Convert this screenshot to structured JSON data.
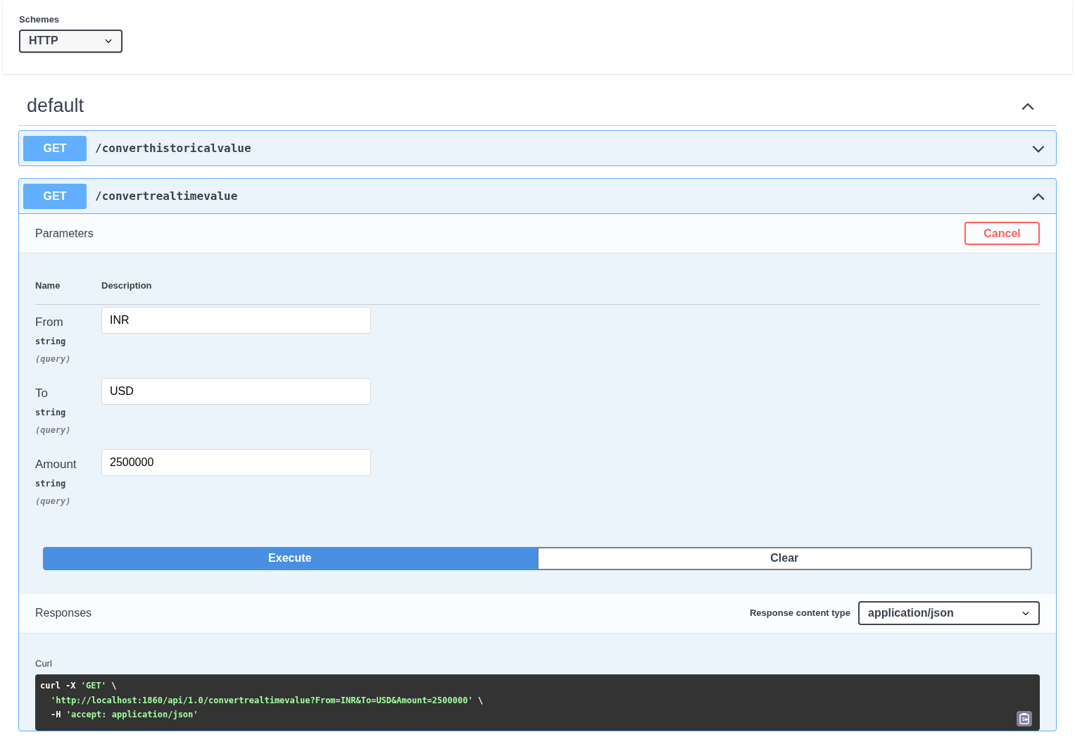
{
  "schemes": {
    "label": "Schemes",
    "value": "HTTP"
  },
  "section": {
    "title": "default",
    "expanded": true
  },
  "operations": [
    {
      "method": "GET",
      "path": "/converthistoricalvalue",
      "expanded": false
    },
    {
      "method": "GET",
      "path": "/convertrealtimevalue",
      "expanded": true,
      "parameters_title": "Parameters",
      "cancel": "Cancel",
      "columns": [
        "Name",
        "Description"
      ],
      "params": [
        {
          "name": "From",
          "type": "string",
          "in": "(query)",
          "value": "INR"
        },
        {
          "name": "To",
          "type": "string",
          "in": "(query)",
          "value": "USD"
        },
        {
          "name": "Amount",
          "type": "string",
          "in": "(query)",
          "value": "2500000"
        }
      ],
      "execute": "Execute",
      "clear": "Clear",
      "responses_title": "Responses",
      "content_type_label": "Response content type",
      "content_type": "application/json",
      "curl_label": "Curl",
      "curl_lines": [
        {
          "indent": false,
          "parts": [
            {
              "kind": "plain",
              "text": "curl -X "
            },
            {
              "kind": "string",
              "text": "'GET'"
            },
            {
              "kind": "plain",
              "text": " \\"
            }
          ]
        },
        {
          "indent": true,
          "parts": [
            {
              "kind": "string",
              "text": "'http://localhost:1860/api/1.0/convertrealtimevalue?From=INR&To=USD&Amount=2500000'"
            },
            {
              "kind": "plain",
              "text": " \\"
            }
          ]
        },
        {
          "indent": true,
          "parts": [
            {
              "kind": "plain",
              "text": "-H "
            },
            {
              "kind": "string",
              "text": "'accept: application/json'"
            }
          ]
        }
      ]
    }
  ]
}
